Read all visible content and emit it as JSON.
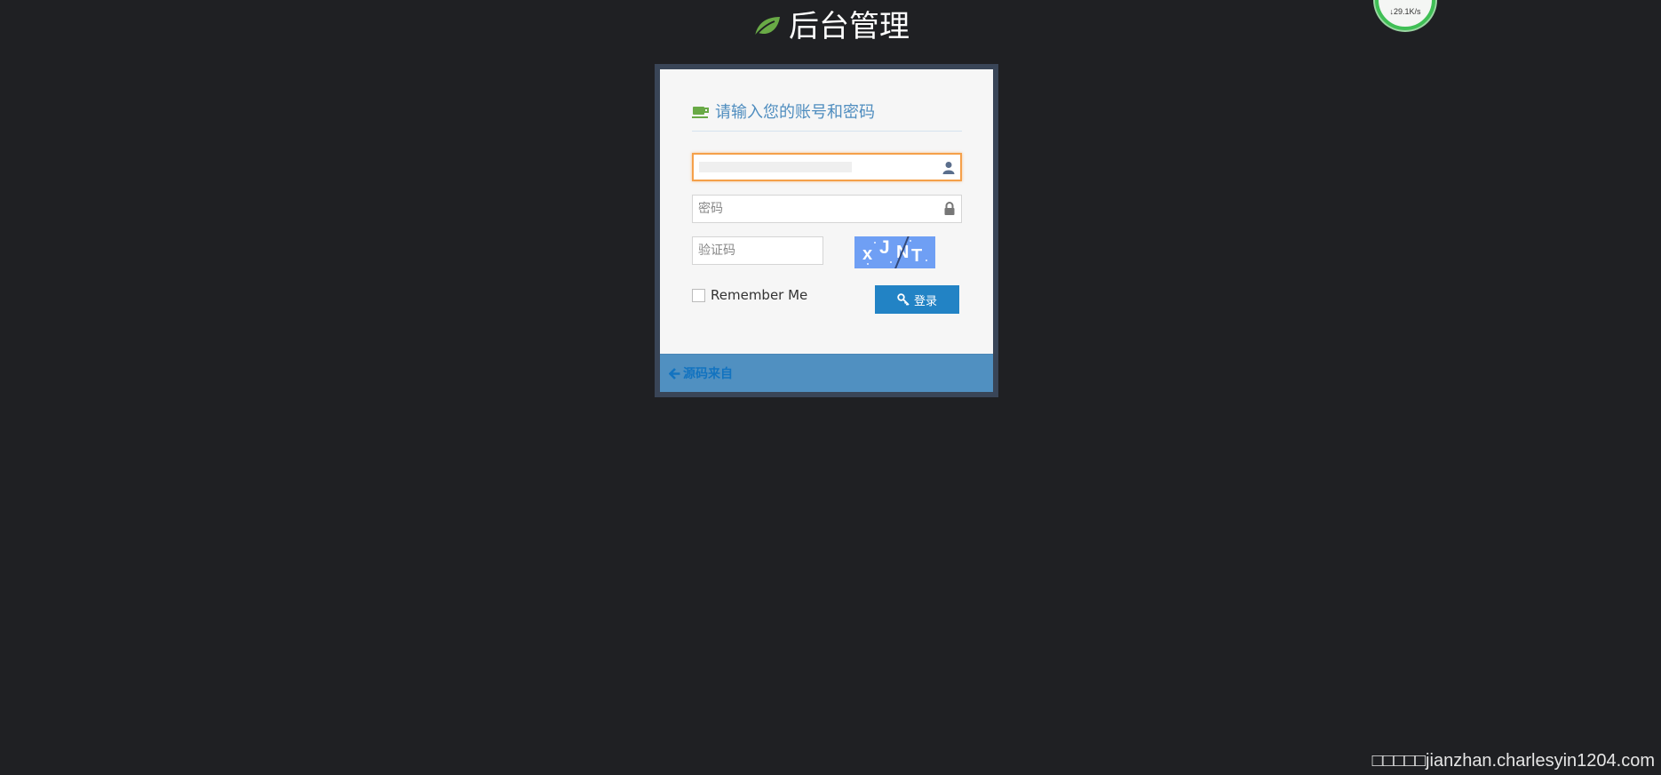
{
  "header": {
    "title": "后台管理",
    "logo_icon": "leaf-icon"
  },
  "speed_widget": {
    "download": "↓29.1K/s"
  },
  "login": {
    "heading": "请输入您的账号和密码",
    "heading_icon": "coffee-icon",
    "username": {
      "value": "",
      "placeholder": "",
      "icon": "user-icon"
    },
    "password": {
      "placeholder": "密码",
      "icon": "lock-icon"
    },
    "captcha": {
      "placeholder": "验证码",
      "chars": [
        "x",
        "J",
        "N",
        "T"
      ]
    },
    "remember_label": "Remember Me",
    "remember_checked": false,
    "submit_label": "登录",
    "submit_icon": "key-icon",
    "back_link": "源码来自",
    "back_icon": "arrow-left-icon"
  },
  "watermark": "□□□□□jianzhan.charlesyin1204.com",
  "colors": {
    "background": "#1f2023",
    "box_border": "#394557",
    "heading": "#4f8dbf",
    "accent_green": "#69aa46",
    "button": "#2283c5",
    "toolbar": "#5090c1",
    "focus_border": "#f5a04a",
    "captcha_bg": "#6f9ff4"
  }
}
